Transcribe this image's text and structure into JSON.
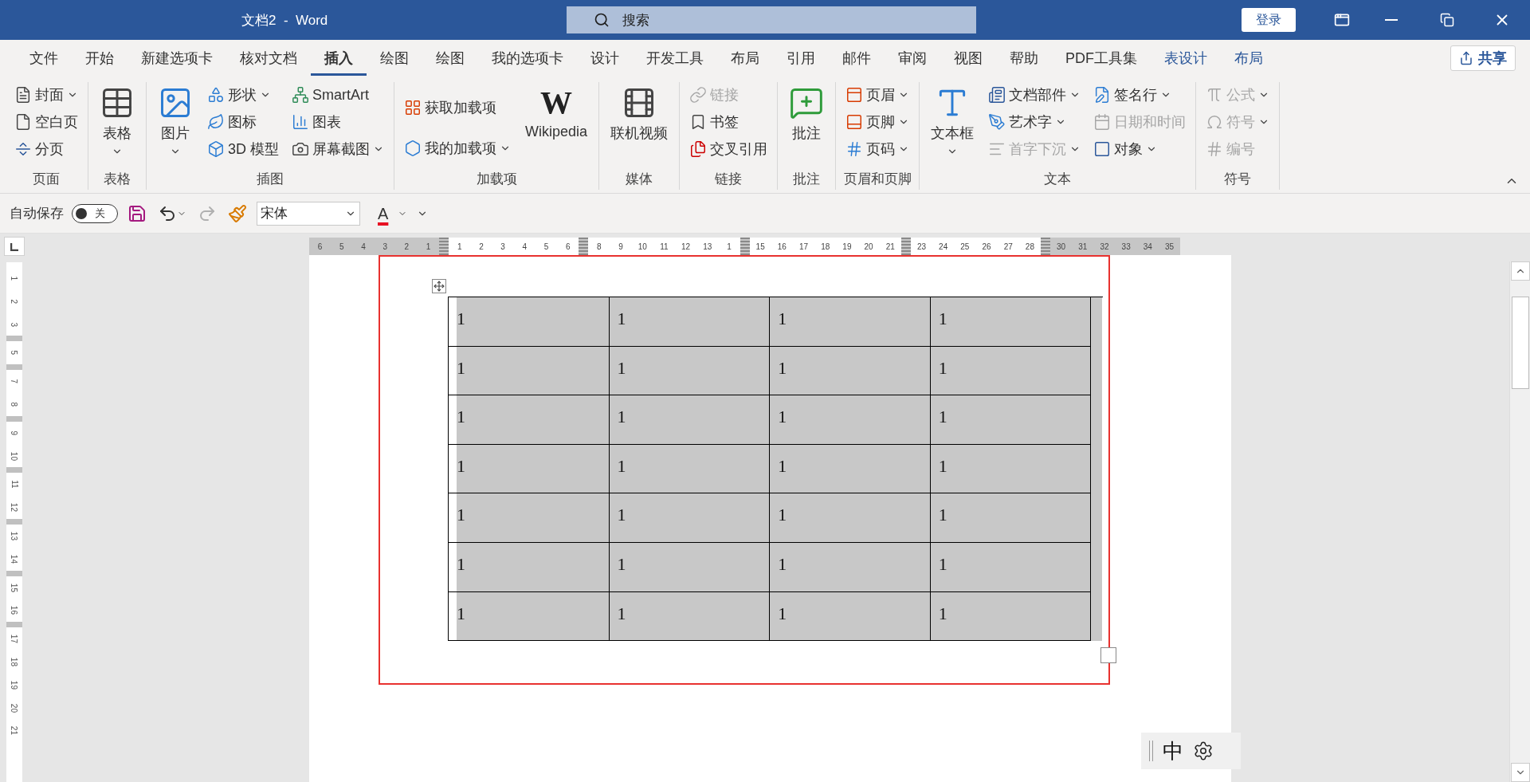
{
  "title_bar": {
    "title": "文档2  -  Word",
    "search": {
      "placeholder": "搜索"
    },
    "login": "登录"
  },
  "tabs": [
    {
      "label": "文件",
      "selected": false,
      "contextual": false
    },
    {
      "label": "开始",
      "selected": false,
      "contextual": false
    },
    {
      "label": "新建选项卡",
      "selected": false,
      "contextual": false
    },
    {
      "label": "核对文档",
      "selected": false,
      "contextual": false
    },
    {
      "label": "插入",
      "selected": true,
      "contextual": false
    },
    {
      "label": "绘图",
      "selected": false,
      "contextual": false
    },
    {
      "label": "绘图",
      "selected": false,
      "contextual": false
    },
    {
      "label": "我的选项卡",
      "selected": false,
      "contextual": false
    },
    {
      "label": "设计",
      "selected": false,
      "contextual": false
    },
    {
      "label": "开发工具",
      "selected": false,
      "contextual": false
    },
    {
      "label": "布局",
      "selected": false,
      "contextual": false
    },
    {
      "label": "引用",
      "selected": false,
      "contextual": false
    },
    {
      "label": "邮件",
      "selected": false,
      "contextual": false
    },
    {
      "label": "审阅",
      "selected": false,
      "contextual": false
    },
    {
      "label": "视图",
      "selected": false,
      "contextual": false
    },
    {
      "label": "帮助",
      "selected": false,
      "contextual": false
    },
    {
      "label": "PDF工具集",
      "selected": false,
      "contextual": false
    },
    {
      "label": "表设计",
      "selected": false,
      "contextual": true
    },
    {
      "label": "布局",
      "selected": false,
      "contextual": true
    }
  ],
  "share": "共享",
  "ribbon_groups": [
    {
      "label": "页面",
      "columns": [
        {
          "kind": "stack",
          "items": [
            {
              "label": "封面",
              "dropdown": true,
              "disabled": false
            },
            {
              "label": "空白页",
              "dropdown": false,
              "disabled": false
            },
            {
              "label": "分页",
              "dropdown": false,
              "disabled": false
            }
          ]
        }
      ]
    },
    {
      "label": "表格",
      "columns": [
        {
          "kind": "large",
          "items": [
            {
              "label": "表格",
              "dropdown": true,
              "disabled": false
            }
          ]
        }
      ]
    },
    {
      "label": "插图",
      "columns": [
        {
          "kind": "large",
          "items": [
            {
              "label": "图片",
              "dropdown": true,
              "disabled": false
            }
          ]
        },
        {
          "kind": "stack",
          "items": [
            {
              "label": "形状",
              "dropdown": true,
              "disabled": false
            },
            {
              "label": "图标",
              "dropdown": false,
              "disabled": false
            },
            {
              "label": "3D 模型",
              "dropdown": false,
              "disabled": false
            }
          ]
        },
        {
          "kind": "stack",
          "items": [
            {
              "label": "SmartArt",
              "dropdown": false,
              "disabled": false
            },
            {
              "label": "图表",
              "dropdown": false,
              "disabled": false
            },
            {
              "label": "屏幕截图",
              "dropdown": true,
              "disabled": false
            }
          ]
        }
      ]
    },
    {
      "label": "加载项",
      "columns": [
        {
          "kind": "stack2",
          "items": [
            {
              "label": "获取加载项",
              "dropdown": false,
              "disabled": false
            },
            {
              "label": "我的加载项",
              "dropdown": true,
              "disabled": false
            }
          ]
        },
        {
          "kind": "logo",
          "logo": "W",
          "items": [
            {
              "label": "Wikipedia",
              "dropdown": false,
              "disabled": false
            }
          ]
        }
      ]
    },
    {
      "label": "媒体",
      "columns": [
        {
          "kind": "large",
          "items": [
            {
              "label": "联机视频",
              "dropdown": false,
              "disabled": false
            }
          ]
        }
      ]
    },
    {
      "label": "链接",
      "columns": [
        {
          "kind": "stack",
          "items": [
            {
              "label": "链接",
              "dropdown": false,
              "disabled": true
            },
            {
              "label": "书签",
              "dropdown": false,
              "disabled": false
            },
            {
              "label": "交叉引用",
              "dropdown": false,
              "disabled": false
            }
          ]
        }
      ]
    },
    {
      "label": "批注",
      "columns": [
        {
          "kind": "large",
          "items": [
            {
              "label": "批注",
              "dropdown": false,
              "disabled": false
            }
          ]
        }
      ]
    },
    {
      "label": "页眉和页脚",
      "columns": [
        {
          "kind": "stack",
          "items": [
            {
              "label": "页眉",
              "dropdown": true,
              "disabled": false
            },
            {
              "label": "页脚",
              "dropdown": true,
              "disabled": false
            },
            {
              "label": "页码",
              "dropdown": true,
              "disabled": false
            }
          ]
        }
      ]
    },
    {
      "label": "文本",
      "columns": [
        {
          "kind": "large",
          "items": [
            {
              "label": "文本框",
              "dropdown": true,
              "disabled": false
            }
          ]
        },
        {
          "kind": "stack",
          "items": [
            {
              "label": "文档部件",
              "dropdown": true,
              "disabled": false
            },
            {
              "label": "艺术字",
              "dropdown": true,
              "disabled": false
            },
            {
              "label": "首字下沉",
              "dropdown": true,
              "disabled": true
            }
          ]
        },
        {
          "kind": "stack",
          "items": [
            {
              "label": "签名行",
              "dropdown": true,
              "disabled": false
            },
            {
              "label": "日期和时间",
              "dropdown": false,
              "disabled": true
            },
            {
              "label": "对象",
              "dropdown": true,
              "disabled": false
            }
          ]
        }
      ]
    },
    {
      "label": "符号",
      "columns": [
        {
          "kind": "stack",
          "items": [
            {
              "label": "公式",
              "dropdown": true,
              "disabled": true
            },
            {
              "label": "符号",
              "dropdown": true,
              "disabled": true
            },
            {
              "label": "编号",
              "dropdown": false,
              "disabled": true
            }
          ]
        }
      ]
    }
  ],
  "quick_access": {
    "autosave_label": "自动保存",
    "autosave": {
      "on": false,
      "label": "关"
    },
    "redo_disabled": true,
    "font": "宋体",
    "font_color_letter": "A"
  },
  "horizontal_ruler": [
    {
      "text": "6",
      "kind": "margin"
    },
    {
      "text": "5",
      "kind": "margin"
    },
    {
      "text": "4",
      "kind": "margin"
    },
    {
      "text": "3",
      "kind": "margin"
    },
    {
      "text": "2",
      "kind": "margin"
    },
    {
      "text": "1",
      "kind": "margin"
    },
    {
      "kind": "marker"
    },
    {
      "text": "1",
      "kind": "number"
    },
    {
      "text": "2",
      "kind": "number"
    },
    {
      "text": "3",
      "kind": "number"
    },
    {
      "text": "4",
      "kind": "number"
    },
    {
      "text": "5",
      "kind": "number"
    },
    {
      "text": "6",
      "kind": "number"
    },
    {
      "kind": "marker"
    },
    {
      "text": "8",
      "kind": "number"
    },
    {
      "text": "9",
      "kind": "number"
    },
    {
      "text": "10",
      "kind": "number"
    },
    {
      "text": "11",
      "kind": "number"
    },
    {
      "text": "12",
      "kind": "number"
    },
    {
      "text": "13",
      "kind": "number"
    },
    {
      "text": "1",
      "kind": "number"
    },
    {
      "kind": "marker"
    },
    {
      "text": "15",
      "kind": "number"
    },
    {
      "text": "16",
      "kind": "number"
    },
    {
      "text": "17",
      "kind": "number"
    },
    {
      "text": "18",
      "kind": "number"
    },
    {
      "text": "19",
      "kind": "number"
    },
    {
      "text": "20",
      "kind": "number"
    },
    {
      "text": "21",
      "kind": "number"
    },
    {
      "kind": "marker"
    },
    {
      "text": "23",
      "kind": "number"
    },
    {
      "text": "24",
      "kind": "number"
    },
    {
      "text": "25",
      "kind": "number"
    },
    {
      "text": "26",
      "kind": "number"
    },
    {
      "text": "27",
      "kind": "number"
    },
    {
      "text": "28",
      "kind": "number"
    },
    {
      "kind": "marker"
    },
    {
      "text": "30",
      "kind": "margin"
    },
    {
      "text": "31",
      "kind": "margin"
    },
    {
      "text": "32",
      "kind": "margin"
    },
    {
      "text": "33",
      "kind": "margin"
    },
    {
      "text": "34",
      "kind": "margin"
    },
    {
      "text": "35",
      "kind": "margin"
    }
  ],
  "vertical_ruler": [
    {
      "text": "1",
      "kind": "number"
    },
    {
      "text": "2",
      "kind": "number"
    },
    {
      "text": "3",
      "kind": "number"
    },
    {
      "kind": "marker"
    },
    {
      "text": "5",
      "kind": "number"
    },
    {
      "kind": "marker"
    },
    {
      "text": "7",
      "kind": "number"
    },
    {
      "text": "8",
      "kind": "number"
    },
    {
      "kind": "marker"
    },
    {
      "text": "9",
      "kind": "number"
    },
    {
      "text": "10",
      "kind": "number"
    },
    {
      "kind": "marker"
    },
    {
      "text": "11",
      "kind": "number"
    },
    {
      "text": "12",
      "kind": "number"
    },
    {
      "kind": "marker"
    },
    {
      "text": "13",
      "kind": "number"
    },
    {
      "text": "14",
      "kind": "number"
    },
    {
      "kind": "marker"
    },
    {
      "text": "15",
      "kind": "number"
    },
    {
      "text": "16",
      "kind": "number"
    },
    {
      "kind": "marker"
    },
    {
      "text": "17",
      "kind": "number"
    },
    {
      "text": "18",
      "kind": "number"
    },
    {
      "text": "19",
      "kind": "number"
    },
    {
      "text": "20",
      "kind": "number"
    },
    {
      "text": "21",
      "kind": "number"
    }
  ],
  "table": {
    "selected": true,
    "rows": [
      [
        "1",
        "1",
        "1",
        "1"
      ],
      [
        "1",
        "1",
        "1",
        "1"
      ],
      [
        "1",
        "1",
        "1",
        "1"
      ],
      [
        "1",
        "1",
        "1",
        "1"
      ],
      [
        "1",
        "1",
        "1",
        "1"
      ],
      [
        "1",
        "1",
        "1",
        "1"
      ],
      [
        "1",
        "1",
        "1",
        "1"
      ]
    ]
  },
  "ime_bar": {
    "mode": "中"
  }
}
